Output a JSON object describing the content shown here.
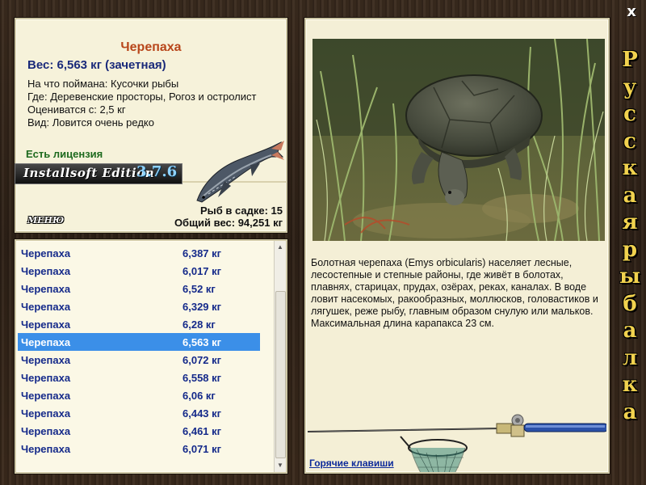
{
  "window": {
    "close_label": "x",
    "side_title": "Русская рыбалка",
    "side_title_letters": [
      "Р",
      "у",
      "с",
      "с",
      "к",
      "а",
      "я",
      "р",
      "ы",
      "б",
      "а",
      "л",
      "к",
      "а"
    ]
  },
  "fish": {
    "name": "Черепаха",
    "weight_line": "Вес: 6,563 кг (зачетная)",
    "bait_line": "На что поймана: Кусочки рыбы",
    "where_line": "Где: Деревенские просторы, Рогоз и остролист",
    "valued_line": "Оцениватся с: 2,5 кг",
    "kind_line": "Вид: Ловится очень редко",
    "license": "Есть лицензия"
  },
  "brand": {
    "text": "Installsoft Edition",
    "version": "3.7.6"
  },
  "stats": {
    "count_line": "Рыб в садке: 15",
    "total_line": "Общий вес: 94,251 кг"
  },
  "menu": {
    "label": "МЕНЮ"
  },
  "catch_list": [
    {
      "name": "Черепаха",
      "weight": "6,387 кг"
    },
    {
      "name": "Черепаха",
      "weight": "6,017 кг"
    },
    {
      "name": "Черепаха",
      "weight": "6,52 кг"
    },
    {
      "name": "Черепаха",
      "weight": "6,329 кг"
    },
    {
      "name": "Черепаха",
      "weight": "6,28 кг"
    },
    {
      "name": "Черепаха",
      "weight": "6,563 кг"
    },
    {
      "name": "Черепаха",
      "weight": "6,072 кг"
    },
    {
      "name": "Черепаха",
      "weight": "6,558 кг"
    },
    {
      "name": "Черепаха",
      "weight": "6,06 кг"
    },
    {
      "name": "Черепаха",
      "weight": "6,443 кг"
    },
    {
      "name": "Черепаха",
      "weight": "6,461 кг"
    },
    {
      "name": "Черепаха",
      "weight": "6,071 кг"
    }
  ],
  "selected_index": 5,
  "detail": {
    "description": "Болотная черепаха (Emys orbicularis) населяет лесные, лесостепные и степные районы, где живёт в болотах, плавнях, старицах, прудах, озёрах, реках, каналах. В воде ловит насекомых, ракообразных, моллюсков, головастиков и лягушек, реже рыбу, главным образом снулую или мальков. Максимальная длина карапакса 23 см.",
    "hotkeys_label": "Горячие клавиши"
  },
  "colors": {
    "title": "#b8461a",
    "weight": "#1a2a7a",
    "license": "#1e6a1e",
    "list_text": "#152a8a",
    "selection": "#3b8fe8",
    "side_title": "#f1d24e"
  },
  "icons": {
    "close": "close-icon",
    "fish_picture": "sturgeon-fish-image",
    "photo": "turtle-photo",
    "rod": "fishing-rod-image",
    "net": "landing-net-image"
  }
}
